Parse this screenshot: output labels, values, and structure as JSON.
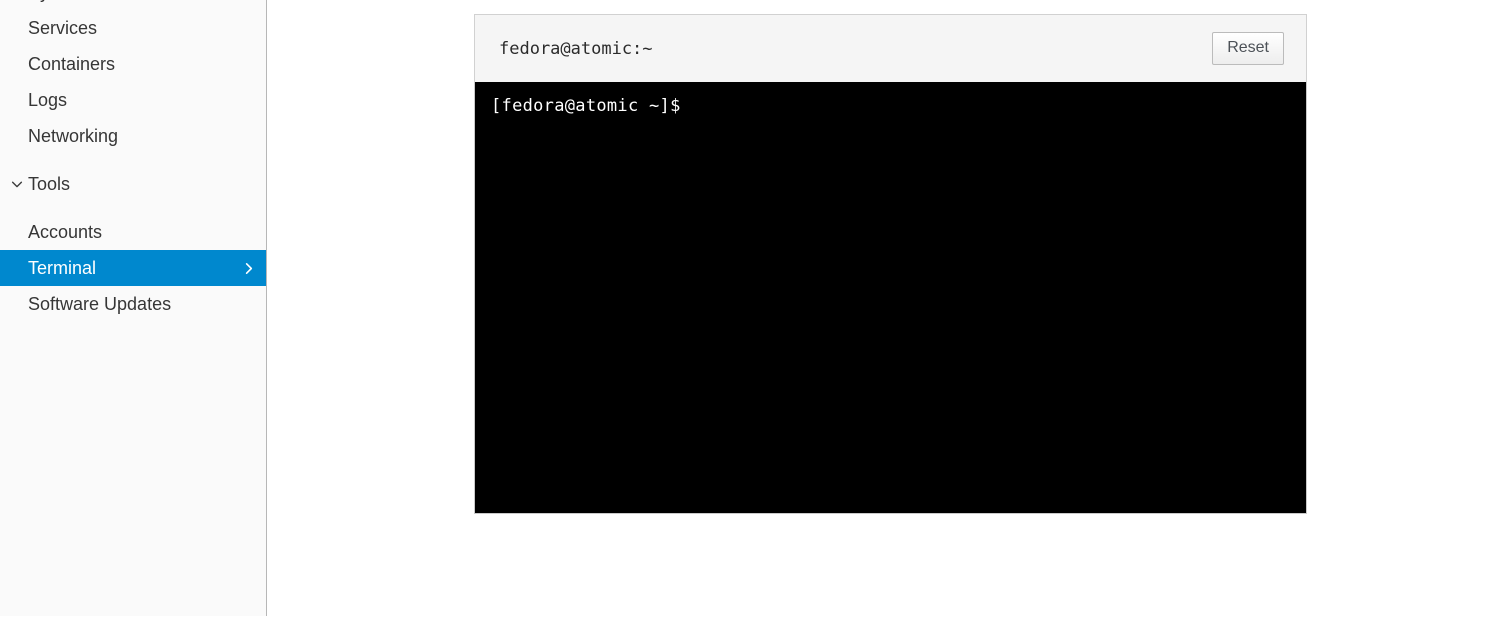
{
  "sidebar": {
    "items": [
      {
        "label": "System",
        "selected": false,
        "has_chevron": false
      },
      {
        "label": "Services",
        "selected": false,
        "has_chevron": false
      },
      {
        "label": "Containers",
        "selected": false,
        "has_chevron": false
      },
      {
        "label": "Logs",
        "selected": false,
        "has_chevron": false
      },
      {
        "label": "Networking",
        "selected": false,
        "has_chevron": false
      }
    ],
    "section": {
      "label": "Tools",
      "expanded": true,
      "icon": "chevron-down-icon"
    },
    "tools_items": [
      {
        "label": "Accounts",
        "selected": false,
        "has_chevron": false
      },
      {
        "label": "Terminal",
        "selected": true,
        "has_chevron": true
      },
      {
        "label": "Software Updates",
        "selected": false,
        "has_chevron": false
      }
    ],
    "selected_accent_color": "#0088ce",
    "background_color": "#fafafa",
    "text_color": "#363636"
  },
  "terminal": {
    "title": "fedora@atomic:~",
    "reset_label": "Reset",
    "lines": [
      "[fedora@atomic ~]$"
    ],
    "background_color": "#000000",
    "foreground_color": "#ffffff",
    "header_background_color": "#f5f5f5"
  }
}
